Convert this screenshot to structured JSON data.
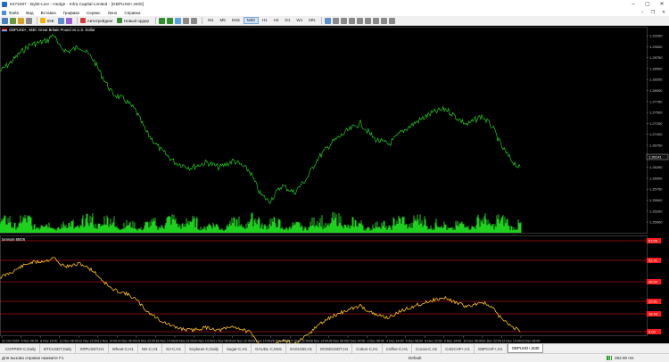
{
  "window": {
    "title": "6473487 - Bybit-Live - Hedge - Infra Capital Limited - [GBPUSD+,M30]",
    "controls": [
      "–",
      "▢",
      "✕"
    ]
  },
  "menu": {
    "items": [
      "Файл",
      "Вид",
      "Вставка",
      "Графики",
      "Сервис",
      "Окно",
      "Справка"
    ]
  },
  "toolbar": {
    "algo_label": "Автотрейдинг",
    "new_order_label": "Новый ордер",
    "ide_label": "IDE",
    "timeframes": [
      "M1",
      "M5",
      "M15",
      "M30",
      "H1",
      "H4",
      "D1",
      "W1",
      "MN"
    ],
    "active_timeframe": "M30"
  },
  "chart": {
    "header": "GBPUSD+, M30: Great Britain Pound vs U.S. Dollar",
    "indicator_label": "tamsuls 6M26",
    "price_labels": [
      "1.29250",
      "1.29000",
      "1.28750",
      "1.28500",
      "1.28250",
      "1.28000",
      "1.27750",
      "1.27500",
      "1.27250",
      "1.27000",
      "1.26750",
      "1.26500",
      "1.26250",
      "1.26000",
      "1.25750",
      "1.25500",
      "1.25250",
      "1.25000"
    ],
    "current_price": "1.26141",
    "indicator_levels": [
      "63.06",
      "52.31",
      "40.00",
      "20.51",
      "18.43",
      "5.03"
    ],
    "time_labels": [
      "31 Oct 2024",
      "5 Nov 06:00",
      "8 Nov 14:00",
      "11 Nov 06:00",
      "12 Nov 22:00",
      "13 Nov 14:00",
      "14 Nov 06:00",
      "15 Nov 22:00",
      "18 Nov 14:00",
      "19 Nov 22:00",
      "20 Nov 14:00",
      "21 Nov 06:00",
      "22 Nov 22:00",
      "25 Nov 14:00",
      "26 Nov 06:00",
      "27 Nov 22:00",
      "28 Nov 14:00",
      "29 Nov 06:00",
      "2 Dec 14:00",
      "3 Dec 06:00",
      "4 Dec 14:00",
      "5 Dec 06:00",
      "6 Dec 22:00",
      "9 Dec 14:00",
      "10 Dec 06:00",
      "11 Dec 22:00",
      "12 Dec 14:00",
      "13 Dec 06:00"
    ],
    "colors": {
      "price_line": "#1fd11f",
      "volume": "#1fd11f",
      "indicator_line": "#ffc21a",
      "level_line": "#ff1a1a",
      "grid": "#2a2a2a"
    }
  },
  "tabs": {
    "items": [
      "COPPER-C,Daily",
      "BTCUSDT,Daily",
      "XRPUSDT,H1",
      "Wheat-C,H1",
      "NG-C,H1",
      "OJ-C,H1",
      "Soybean-C,Daily",
      "Sugar-C,H1",
      "GAUDL-C,M15",
      "XAGUSD,H1",
      "DOGEUSDT,H1",
      "Cotton-C,H1",
      "Coffee-C,H1",
      "Cocoa-C,H1",
      "CADCHF+,H1",
      "GBPCHF+,H1",
      "GBPUSD+,M30"
    ],
    "active_index": 16
  },
  "status": {
    "help": "Для вызова справки нажмите F1",
    "profile": "Default",
    "traffic": "282.90 ms"
  }
}
